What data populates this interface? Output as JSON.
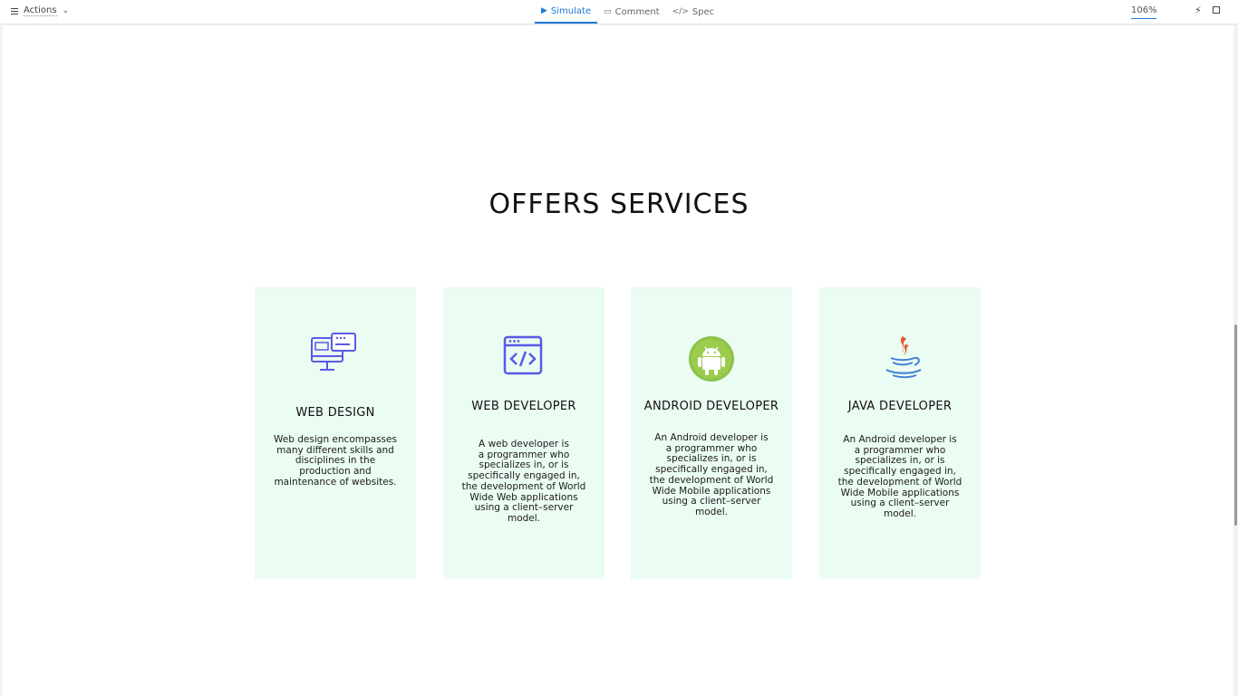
{
  "toolbar": {
    "actions_label": "Actions",
    "modes": [
      {
        "label": "Simulate",
        "icon": "play-icon",
        "active": true
      },
      {
        "label": "Comment",
        "icon": "comment-icon",
        "active": false
      },
      {
        "label": "Spec",
        "icon": "code-icon",
        "active": false
      }
    ],
    "zoom": "106%"
  },
  "page": {
    "title": "OFFERS SERVICES",
    "cards": [
      {
        "icon": "monitor-design-icon",
        "title": "WEB DESIGN",
        "text": "Web design encompasses\nmany different skills and\ndisciplines in the\nproduction and\nmaintenance of websites."
      },
      {
        "icon": "browser-code-icon",
        "title": "WEB DEVELOPER",
        "text": "A web developer is\na programmer who\nspecializes in, or is\nspecifically engaged in,\nthe development of World\nWide Web applications\nusing a client–server\nmodel."
      },
      {
        "icon": "android-icon",
        "title": "ANDROID DEVELOPER",
        "text": "An Android developer is\na programmer who\nspecializes in, or is\nspecifically engaged in,\nthe development of World\nWide Mobile applications\nusing a client–server\nmodel."
      },
      {
        "icon": "java-icon",
        "title": "JAVA DEVELOPER",
        "text": "An Android developer is\na programmer who\nspecializes in, or is\nspecifically engaged in,\nthe development of World\nWide Mobile applications\nusing a client–server\nmodel."
      }
    ]
  },
  "colors": {
    "accent": "#1b7ad6",
    "card_bg": "#ebfcf2",
    "icon_purple": "#5a5ae6",
    "android_green": "#8bc34a",
    "java_red": "#e4572e",
    "java_blue": "#3f7fd6"
  }
}
